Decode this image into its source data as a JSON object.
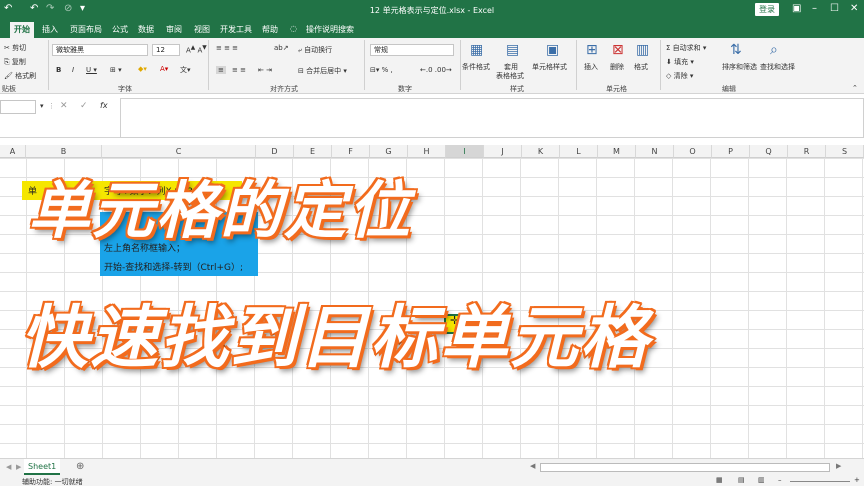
{
  "title": {
    "document": "12 单元格表示与定位.xlsx  -  Excel",
    "login": "登录"
  },
  "tabs": [
    "开始",
    "插入",
    "页面布局",
    "公式",
    "数据",
    "审阅",
    "视图",
    "开发工具",
    "帮助"
  ],
  "tell_me": "操作说明搜索",
  "clipboard": {
    "cut": "剪切",
    "copy": "复制",
    "painter": "格式刷",
    "label": "贴板"
  },
  "font": {
    "name": "微软雅黑",
    "size": "12",
    "label": "字体"
  },
  "alignment": {
    "wrap": "自动换行",
    "merge": "合并后居中",
    "label": "对齐方式"
  },
  "number": {
    "format": "常规",
    "label": "数字"
  },
  "styles": {
    "conditional": "条件格式",
    "table_l1": "套用",
    "table_l2": "表格格式",
    "cell_styles": "单元格样式",
    "label": "样式"
  },
  "cells": {
    "insert": "插入",
    "delete": "删除",
    "format": "格式",
    "label": "单元格"
  },
  "editing": {
    "autosum": "自动求和",
    "fill": "填充",
    "clear": "清除",
    "sort": "排序和筛选",
    "find": "查找和选择",
    "label": "编辑"
  },
  "columns": [
    "A",
    "B",
    "C",
    "D",
    "E",
    "F",
    "G",
    "H",
    "I",
    "J",
    "K",
    "L",
    "M",
    "N",
    "O",
    "P",
    "Q",
    "R",
    "S"
  ],
  "cell_text": {
    "r1_left": "单",
    "r1_right": "字母+数字：列X+ F3",
    "r2": "定",
    "r3": "左上角名称框输入；",
    "r4": "开始-查找和选择-转到（Ctrl+G）;"
  },
  "overlay": {
    "line1": "单元格的定位",
    "line2": "快速找到目标单元格"
  },
  "sheet": {
    "name": "Sheet1"
  },
  "status": {
    "text": "辅助功能: 一切就绪"
  }
}
